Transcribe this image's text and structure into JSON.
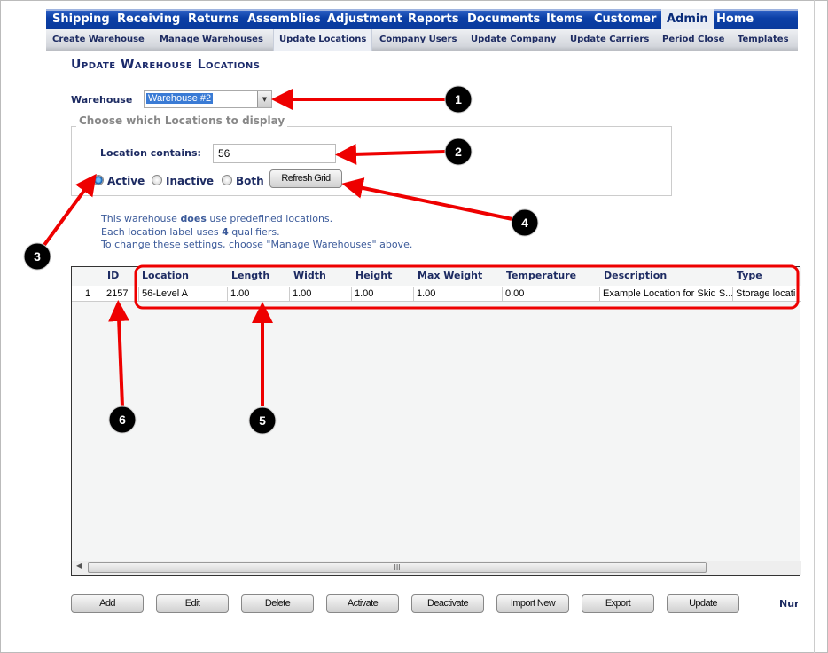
{
  "nav": {
    "items": [
      "Shipping",
      "Receiving",
      "Returns",
      "Assemblies",
      "Adjustment",
      "Reports",
      "Documents",
      "Items",
      "Customer",
      "Admin",
      "Home"
    ],
    "selected": "Admin"
  },
  "subnav": {
    "items": [
      "Create Warehouse",
      "Manage Warehouses",
      "Update Locations",
      "Company Users",
      "Update Company",
      "Update Carriers",
      "Period Close",
      "Templates"
    ],
    "selected": "Update Locations"
  },
  "page_title": "Update Warehouse Locations",
  "warehouse": {
    "label": "Warehouse",
    "value": "Warehouse #2"
  },
  "filter": {
    "legend": "Choose which Locations to display",
    "location_label": "Location contains:",
    "location_value": "56",
    "radios": [
      {
        "label": "Active",
        "checked": true
      },
      {
        "label": "Inactive",
        "checked": false
      },
      {
        "label": "Both",
        "checked": false
      }
    ],
    "refresh_label": "Refresh Grid"
  },
  "info": {
    "line1_pre": "This warehouse ",
    "line1_bold": "does",
    "line1_post": " use predefined locations.",
    "line2_pre": "Each location label uses ",
    "line2_bold": "4",
    "line2_post": " qualifiers.",
    "line3": "To change these settings, choose \"Manage Warehouses\" above."
  },
  "grid": {
    "columns": [
      "ID",
      "Location",
      "Length",
      "Width",
      "Height",
      "Max Weight",
      "Temperature",
      "Description",
      "Type"
    ],
    "rows": [
      {
        "num": "1",
        "cells": [
          "2157",
          "56-Level A",
          "1.00",
          "1.00",
          "1.00",
          "1.00",
          "0.00",
          "Example Location for Skid S...",
          "Storage locati"
        ]
      }
    ],
    "scroll_grip": "III"
  },
  "buttons": [
    "Add",
    "Edit",
    "Delete",
    "Activate",
    "Deactivate",
    "Import New",
    "Export",
    "Update"
  ],
  "footer_text": "Nur",
  "annotations": {
    "labels": [
      "1",
      "2",
      "3",
      "4",
      "5",
      "6"
    ],
    "color": "#ee0000"
  }
}
